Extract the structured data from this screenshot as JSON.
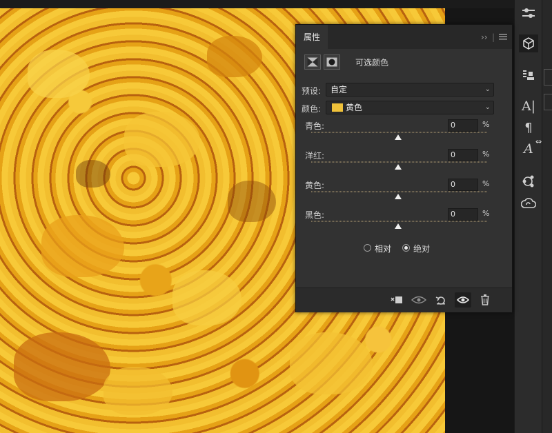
{
  "panel": {
    "tab_label": "属性",
    "adjustment_title": "可选颜色",
    "preset_label": "预设:",
    "preset_value": "自定",
    "colors_label": "颜色:",
    "colors_value": "黄色",
    "colors_swatch": "#f0c23a",
    "sliders": [
      {
        "label": "青色:",
        "value": "0",
        "unit": "%"
      },
      {
        "label": "洋红:",
        "value": "0",
        "unit": "%"
      },
      {
        "label": "黄色:",
        "value": "0",
        "unit": "%"
      },
      {
        "label": "黑色:",
        "value": "0",
        "unit": "%"
      }
    ],
    "method_relative": "相对",
    "method_absolute": "绝对",
    "selected_method": "绝对",
    "collapse_icon": "double-chevron-right",
    "menu_icon": "hamburger"
  },
  "toolbar_right": {
    "items": [
      "adjustments-icon",
      "3d-cube-icon",
      "stamp-icon",
      "character-icon",
      "paragraph-icon",
      "glyphs-icon",
      "share-icon",
      "creative-cloud-icon"
    ]
  },
  "footer_icons": [
    "clip-to-layer-icon",
    "view-previous-state-icon",
    "reset-icon",
    "visibility-eye-icon",
    "trash-icon"
  ],
  "colors": {
    "accent": "#f0c23a",
    "panel_bg": "#323232",
    "canvas": "#e9a81e"
  }
}
